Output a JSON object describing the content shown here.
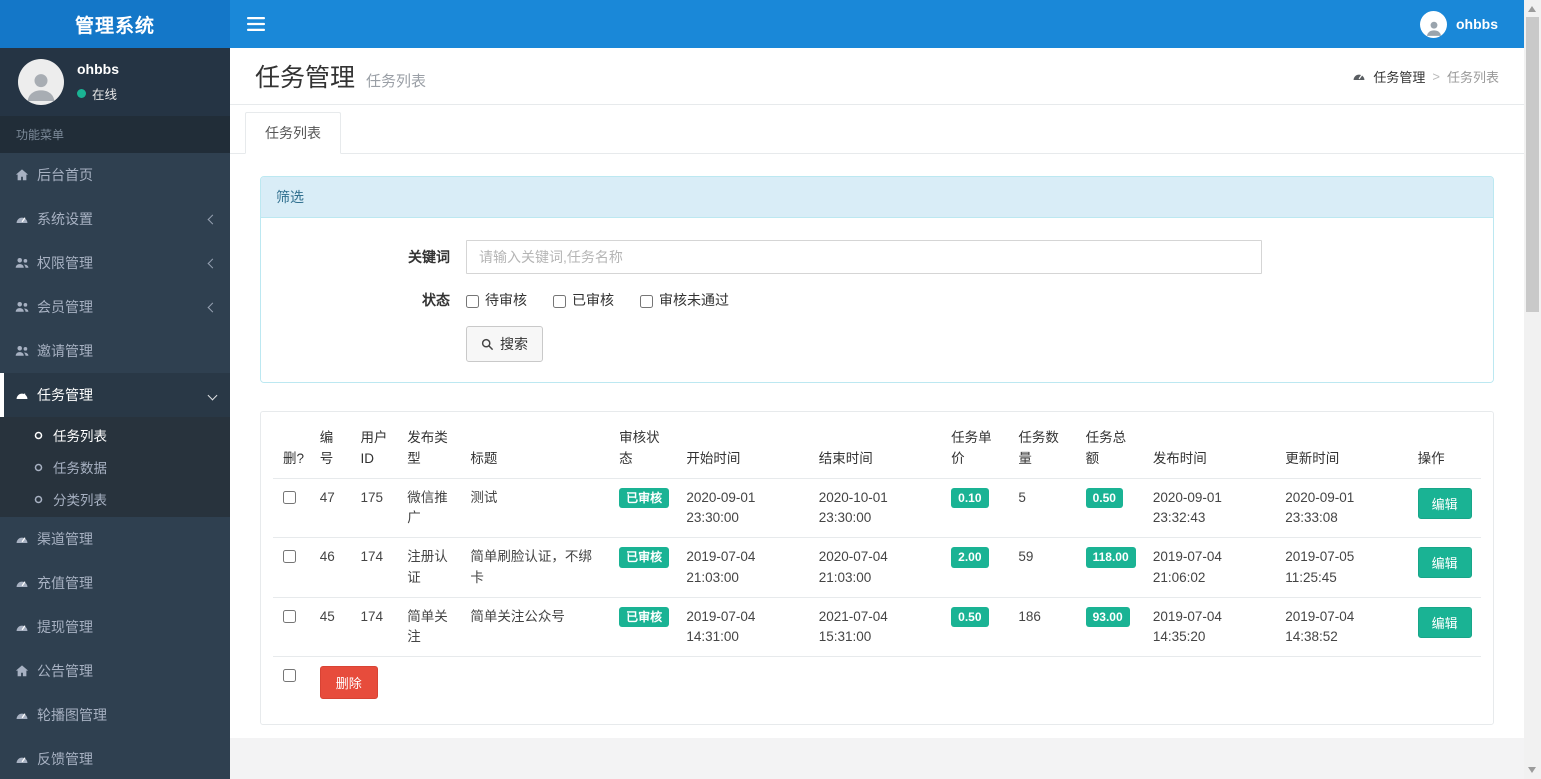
{
  "topbar": {
    "brand": "管理系统",
    "username": "ohbbs"
  },
  "sidebar": {
    "profile": {
      "name": "ohbbs",
      "status": "在线"
    },
    "section_label": "功能菜单",
    "items": [
      {
        "name": "home",
        "label": "后台首页",
        "icon": "home"
      },
      {
        "name": "system-settings",
        "label": "系统设置",
        "icon": "gauge",
        "chevron": "left"
      },
      {
        "name": "permission-management",
        "label": "权限管理",
        "icon": "users",
        "chevron": "left"
      },
      {
        "name": "member-management",
        "label": "会员管理",
        "icon": "users",
        "chevron": "left"
      },
      {
        "name": "invite-management",
        "label": "邀请管理",
        "icon": "users"
      },
      {
        "name": "task-management",
        "label": "任务管理",
        "icon": "gauge",
        "chevron": "down",
        "active": true,
        "children": [
          {
            "name": "task-list",
            "label": "任务列表",
            "active": true
          },
          {
            "name": "task-data",
            "label": "任务数据"
          },
          {
            "name": "category-list",
            "label": "分类列表"
          }
        ]
      },
      {
        "name": "channel-management",
        "label": "渠道管理",
        "icon": "gauge"
      },
      {
        "name": "recharge-management",
        "label": "充值管理",
        "icon": "gauge"
      },
      {
        "name": "withdraw-management",
        "label": "提现管理",
        "icon": "gauge"
      },
      {
        "name": "announcement-management",
        "label": "公告管理",
        "icon": "home"
      },
      {
        "name": "carousel-management",
        "label": "轮播图管理",
        "icon": "gauge"
      },
      {
        "name": "feedback-management",
        "label": "反馈管理",
        "icon": "gauge"
      }
    ]
  },
  "page_header": {
    "title": "任务管理",
    "subtitle": "任务列表",
    "breadcrumb": {
      "items": [
        "任务管理",
        "任务列表"
      ],
      "separator": ">"
    }
  },
  "tabs": [
    {
      "label": "任务列表",
      "active": true
    }
  ],
  "filter": {
    "panel_title": "筛选",
    "keyword_label": "关键词",
    "keyword_placeholder": "请输入关键词,任务名称",
    "keyword_value": "",
    "status_label": "状态",
    "status_options": [
      {
        "label": "待审核",
        "checked": false
      },
      {
        "label": "已审核",
        "checked": false
      },
      {
        "label": "审核未通过",
        "checked": false
      }
    ],
    "search_button": "搜索"
  },
  "table": {
    "headers": [
      "删?",
      "编号",
      "用户ID",
      "发布类型",
      "标题",
      "审核状态",
      "开始时间",
      "结束时间",
      "任务单价",
      "任务数量",
      "任务总额",
      "发布时间",
      "更新时间",
      "操作"
    ],
    "rows": [
      {
        "id": "47",
        "user_id": "175",
        "type": "微信推广",
        "title": "测试",
        "status": "已审核",
        "start": "2020-09-01 23:30:00",
        "end": "2020-10-01 23:30:00",
        "price": "0.10",
        "count": "5",
        "total": "0.50",
        "publish": "2020-09-01 23:32:43",
        "update": "2020-09-01 23:33:08"
      },
      {
        "id": "46",
        "user_id": "174",
        "type": "注册认证",
        "title": "简单刷脸认证，不绑卡",
        "status": "已审核",
        "start": "2019-07-04 21:03:00",
        "end": "2020-07-04 21:03:00",
        "price": "2.00",
        "count": "59",
        "total": "118.00",
        "publish": "2019-07-04 21:06:02",
        "update": "2019-07-05 11:25:45"
      },
      {
        "id": "45",
        "user_id": "174",
        "type": "简单关注",
        "title": "简单关注公众号",
        "status": "已审核",
        "start": "2019-07-04 14:31:00",
        "end": "2021-07-04 15:31:00",
        "price": "0.50",
        "count": "186",
        "total": "93.00",
        "publish": "2019-07-04 14:35:20",
        "update": "2019-07-04 14:38:52"
      }
    ],
    "edit_button": "编辑",
    "delete_button": "删除"
  },
  "colors": {
    "topbar_blue": "#1a88d8",
    "brand_blue": "#1477c8",
    "sidebar_dark": "#2f4050",
    "sidebar_submenu": "#28333d",
    "success_green": "#1ab394",
    "danger_red": "#e74c3c",
    "filter_head_bg": "#d9edf7",
    "filter_border": "#bce8f1",
    "filter_head_text": "#31708f",
    "online_green": "#1ab394"
  }
}
